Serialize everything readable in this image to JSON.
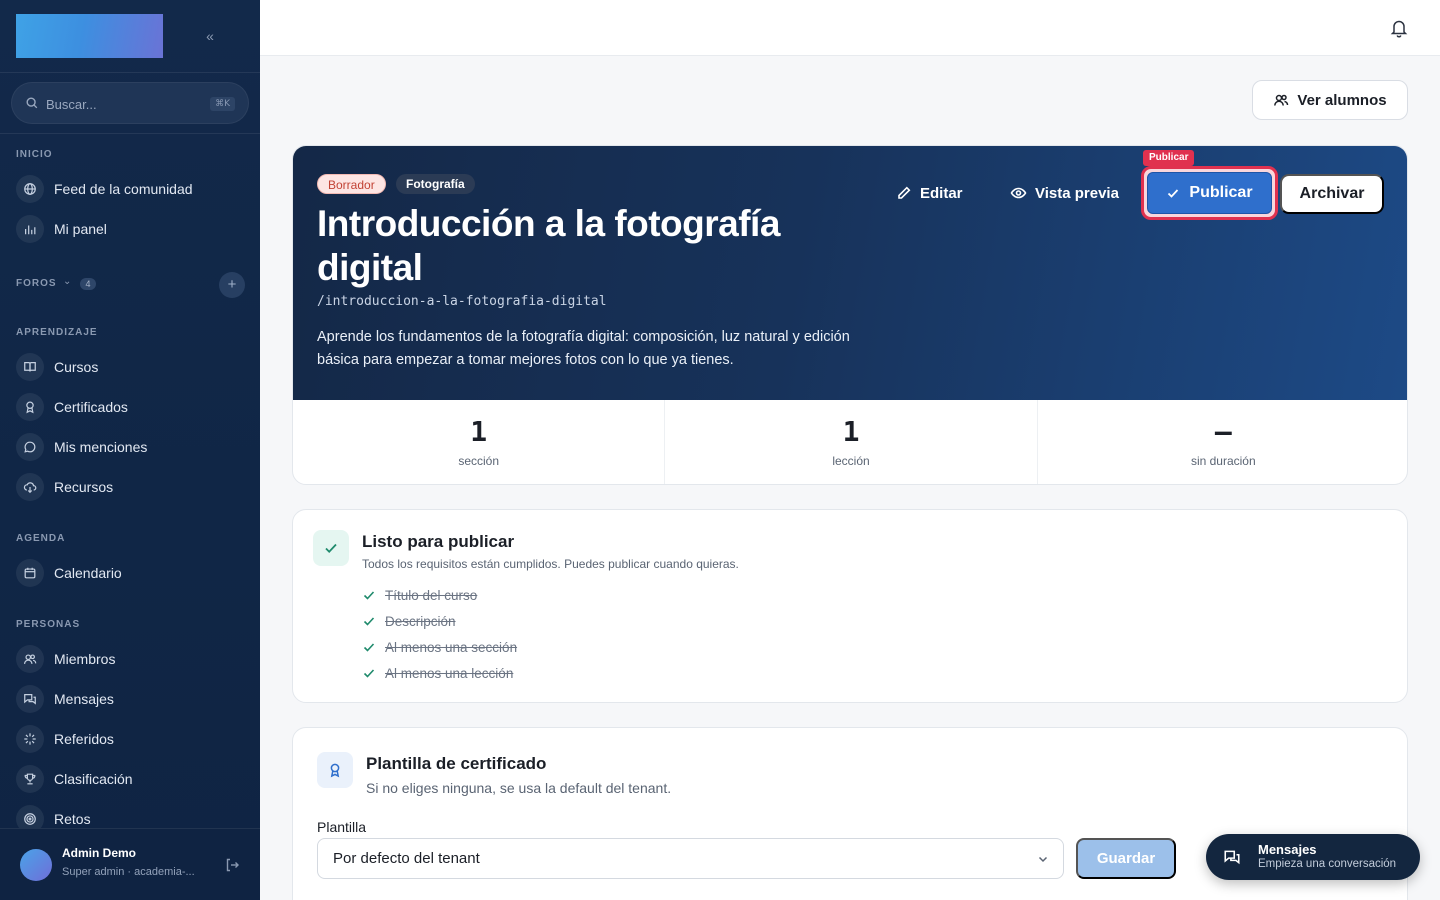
{
  "sidebar": {
    "search": {
      "placeholder": "Buscar...",
      "shortcut": "⌘K"
    },
    "sections": {
      "inicio": "INICIO",
      "foros": "FOROS",
      "foros_count": "4",
      "aprendizaje": "APRENDIZAJE",
      "agenda": "AGENDA",
      "personas": "PERSONAS"
    },
    "items": {
      "feed": "Feed de la comunidad",
      "panel": "Mi panel",
      "cursos": "Cursos",
      "certificados": "Certificados",
      "menciones": "Mis menciones",
      "recursos": "Recursos",
      "calendario": "Calendario",
      "miembros": "Miembros",
      "mensajes": "Mensajes",
      "referidos": "Referidos",
      "clasificacion": "Clasificación",
      "retos": "Retos"
    },
    "user": {
      "name": "Admin Demo",
      "role": "Super admin · academia-..."
    }
  },
  "actions": {
    "ver_alumnos": "Ver alumnos"
  },
  "course": {
    "status_badge": "Borrador",
    "category_badge": "Fotografía",
    "title": "Introducción a la fotografía digital",
    "slug": "/introduccion-a-la-fotografia-digital",
    "description": "Aprende los fundamentos de la fotografía digital: composición, luz natural y edición básica para empezar a tomar mejores fotos con lo que ya tienes.",
    "edit_label": "Editar",
    "preview_label": "Vista previa",
    "publish_tag": "Publicar",
    "publish_label": "Publicar",
    "archive_label": "Archivar",
    "stats": [
      {
        "value": "1",
        "label": "sección"
      },
      {
        "value": "1",
        "label": "lección"
      },
      {
        "value": "—",
        "label": "sin duración"
      }
    ]
  },
  "ready": {
    "title": "Listo para publicar",
    "subtitle": "Todos los requisitos están cumplidos. Puedes publicar cuando quieras.",
    "requirements": [
      "Título del curso",
      "Descripción",
      "Al menos una sección",
      "Al menos una lección"
    ]
  },
  "certificate": {
    "title": "Plantilla de certificado",
    "subtitle": "Si no eliges ninguna, se usa la default del tenant.",
    "field_label": "Plantilla",
    "selected": "Por defecto del tenant",
    "save_label": "Guardar"
  },
  "messages_fab": {
    "title": "Mensajes",
    "subtitle": "Empieza una conversación"
  },
  "colors": {
    "sidebar_bg": "#12294a",
    "accent": "#2f6fcc",
    "highlight": "#e0314f"
  }
}
